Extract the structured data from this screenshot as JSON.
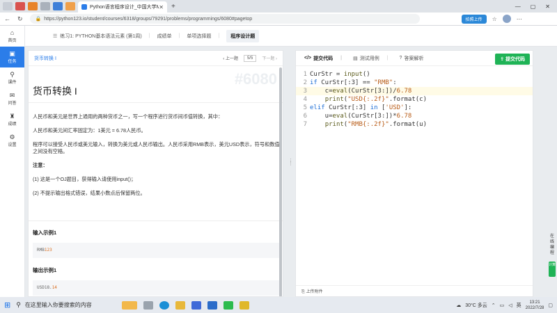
{
  "browser": {
    "active_tab_title": "Python语言程序设计_中国大学M",
    "url": "https://python123.io/student/courses/6318/groups/79291/problems/programmings/6080#pagetop",
    "upload_button": "拍照上传"
  },
  "sidebar": {
    "items": [
      {
        "label": "首页",
        "icon": "⌂"
      },
      {
        "label": "任务",
        "icon": "▣"
      },
      {
        "label": "课件",
        "icon": "⚲"
      },
      {
        "label": "问答",
        "icon": "✉"
      },
      {
        "label": "成绩",
        "icon": "♜"
      },
      {
        "label": "设置",
        "icon": "⚙"
      }
    ]
  },
  "pagenav": {
    "crumb1": "练习1: PYTHON基本语法元素 (第1周)",
    "crumb2": "成绩单",
    "crumb3": "单项选择题",
    "crumb4": "程序设计题"
  },
  "problem": {
    "crumb": "货币转换 I",
    "prev": "上一题",
    "page": "5/5",
    "next": "下一题",
    "id_watermark": "#6080",
    "title": "货币转换 I",
    "paragraphs": [
      "人民币和美元是世界上通用的两种货币之一，写一个程序进行货币间币值转换，其中：",
      "人民币和美元间汇率固定为：1美元 = 6.78人民币。",
      "程序可以接受人民币或美元输入，转换为美元或人民币输出。人民币采用RMB表示，美元USD表示，符号和数值之间没有空格。",
      "注意：",
      "(1) 这是一个OJ题目，获得输入请使用input()；",
      "(2) 不提示输出格式错误，结果小数点后保留两位。"
    ],
    "input_label": "输入示例1",
    "input_example_prefix": "RMB",
    "input_example_num": "123",
    "output_label": "输出示例1",
    "output_example_prefix": "USD18.",
    "output_example_num": "14"
  },
  "editor": {
    "tab1": "提交代码",
    "tab2": "测试用例",
    "tab3": "答案解析",
    "submit": "提交代码",
    "footer": "上传附件",
    "line_numbers": [
      "1",
      "2",
      "3",
      "4",
      "5",
      "6",
      "7"
    ]
  },
  "side_float": {
    "text": "在线编程",
    "badge": "计算"
  },
  "taskbar": {
    "search_placeholder": "在这里输入你要搜索的内容",
    "weather": "30°C 多云",
    "ime": "英",
    "time": "13:21",
    "date": "2022/7/28"
  },
  "colors": {
    "accent": "#2b7de9",
    "submit": "#1fb356"
  }
}
